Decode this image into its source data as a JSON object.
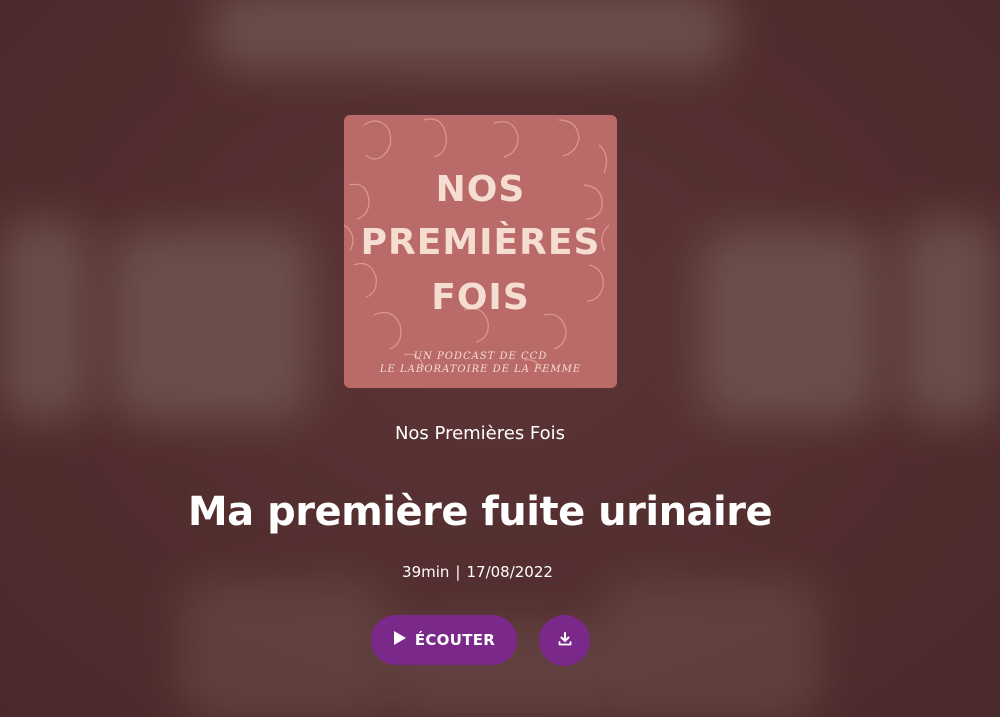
{
  "cover": {
    "title_lines": [
      "NOS",
      "PREMIÈRES",
      "FOIS"
    ],
    "subtitle_lines": [
      "UN PODCAST DE CCD",
      "LE LABORATOIRE DE LA FEMME"
    ]
  },
  "podcast": {
    "name": "Nos Premières Fois"
  },
  "episode": {
    "title": "Ma première fuite urinaire",
    "duration": "39min",
    "separator": "|",
    "date": "17/08/2022"
  },
  "actions": {
    "listen_label": "ÉCOUTER",
    "listen_icon": "play-icon",
    "download_icon": "download-icon"
  },
  "colors": {
    "background": "#5b3335",
    "cover": "#b96a69",
    "accent": "#7a2889",
    "text": "#ffffff"
  }
}
